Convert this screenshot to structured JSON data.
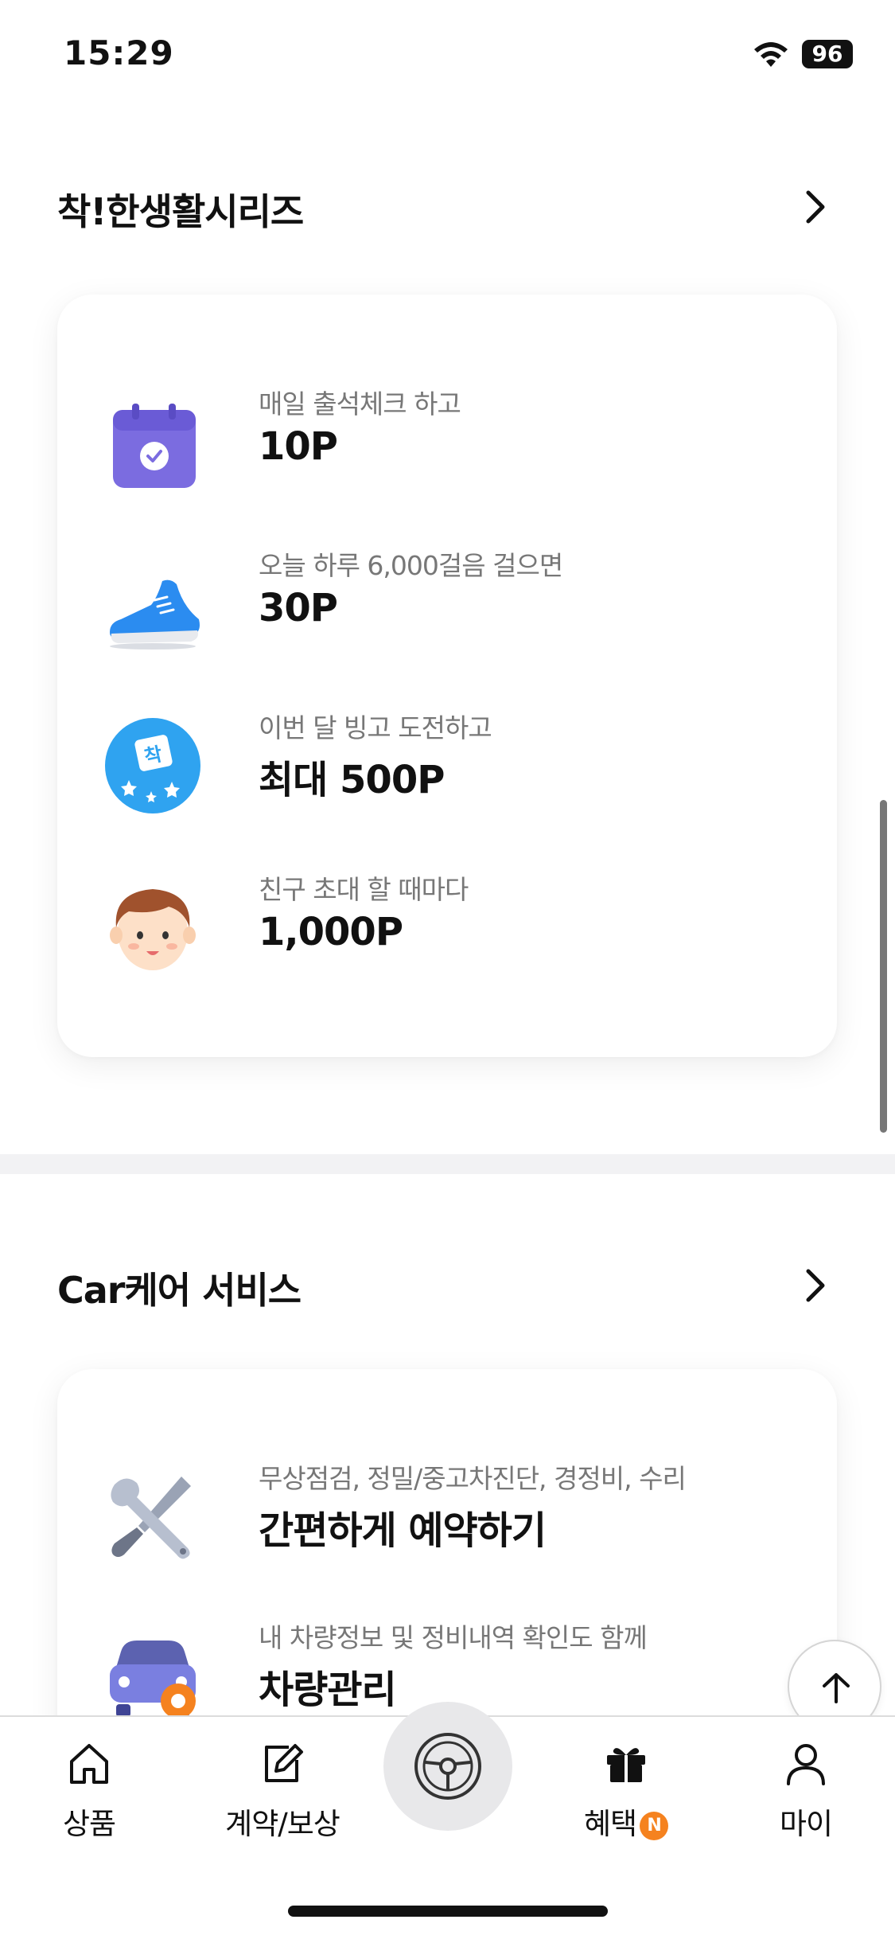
{
  "status_bar": {
    "time": "15:29",
    "battery": "96"
  },
  "sections": [
    {
      "title": "착!한생활시리즈",
      "items": [
        {
          "icon": "calendar-check-icon",
          "subtitle": "매일 출석체크 하고",
          "title": "10P"
        },
        {
          "icon": "sneaker-icon",
          "subtitle": "오늘 하루 6,000걸음 걸으면",
          "title": "30P"
        },
        {
          "icon": "bingo-badge-icon",
          "subtitle": "이번 달 빙고 도전하고",
          "title": "최대 500P",
          "badge_text": "착"
        },
        {
          "icon": "friend-face-icon",
          "subtitle": "친구 초대 할 때마다",
          "title": "1,000P"
        }
      ]
    },
    {
      "title": "Car케어 서비스",
      "items": [
        {
          "icon": "wrench-screwdriver-icon",
          "subtitle": "무상점검, 정밀/중고차진단, 경정비, 수리",
          "title": "간편하게 예약하기"
        },
        {
          "icon": "car-gear-icon",
          "subtitle": "내 차량정보 및 정비내역 확인도 함께",
          "title": "차량관리"
        }
      ]
    }
  ],
  "tab_bar": {
    "tabs": [
      {
        "label": "상품",
        "icon": "home-icon"
      },
      {
        "label": "계약/보상",
        "icon": "edit-icon"
      },
      {
        "label": "",
        "icon": "steering-wheel-icon"
      },
      {
        "label": "혜택",
        "icon": "gift-icon",
        "badge": "N"
      },
      {
        "label": "마이",
        "icon": "person-icon"
      }
    ]
  },
  "colors": {
    "accent_badge": "#f5821f",
    "calendar": "#7b6ce0",
    "shoe": "#2b8cf0",
    "bingo": "#2fa3f0"
  }
}
